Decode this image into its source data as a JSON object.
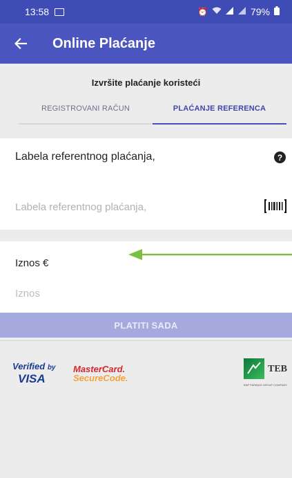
{
  "status_bar": {
    "time": "13:58",
    "battery": "79%",
    "icons": [
      "image-icon",
      "alarm-icon",
      "wifi-icon",
      "signal-icon",
      "signal-icon",
      "battery-icon"
    ]
  },
  "app_bar": {
    "title": "Online Plaćanje",
    "back_icon": "arrow-left-icon"
  },
  "tab_section": {
    "heading": "Izvršite plaćanje koristeći",
    "tabs": [
      {
        "label": "REGISTROVANI RAČUN",
        "active": false
      },
      {
        "label": "PLAĆANJE REFERENCA",
        "active": true
      }
    ]
  },
  "reference_card": {
    "label": "Labela referentnog plaćanja,",
    "input_placeholder": "Labela referentnog plaćanja,",
    "help_icon": "help-icon",
    "scan_icon": "barcode-icon"
  },
  "amount_card": {
    "label": "Iznos €",
    "input_placeholder": "Iznos"
  },
  "pay_button": {
    "label": "PLATITI SADA"
  },
  "logos": {
    "visa_line1": "Verified",
    "visa_by": "by",
    "visa_line2": "VISA",
    "mastercard_line1": "MasterCard.",
    "mastercard_line2": "SecureCode.",
    "teb_name": "TEB",
    "teb_tagline": "BNP PARIBAS GROUP COMPANY"
  },
  "colors": {
    "primary": "#4a55bf",
    "status_bar": "#3f4cb6",
    "button_disabled": "#a6a9dd",
    "annotation_arrow": "#7ac043"
  }
}
